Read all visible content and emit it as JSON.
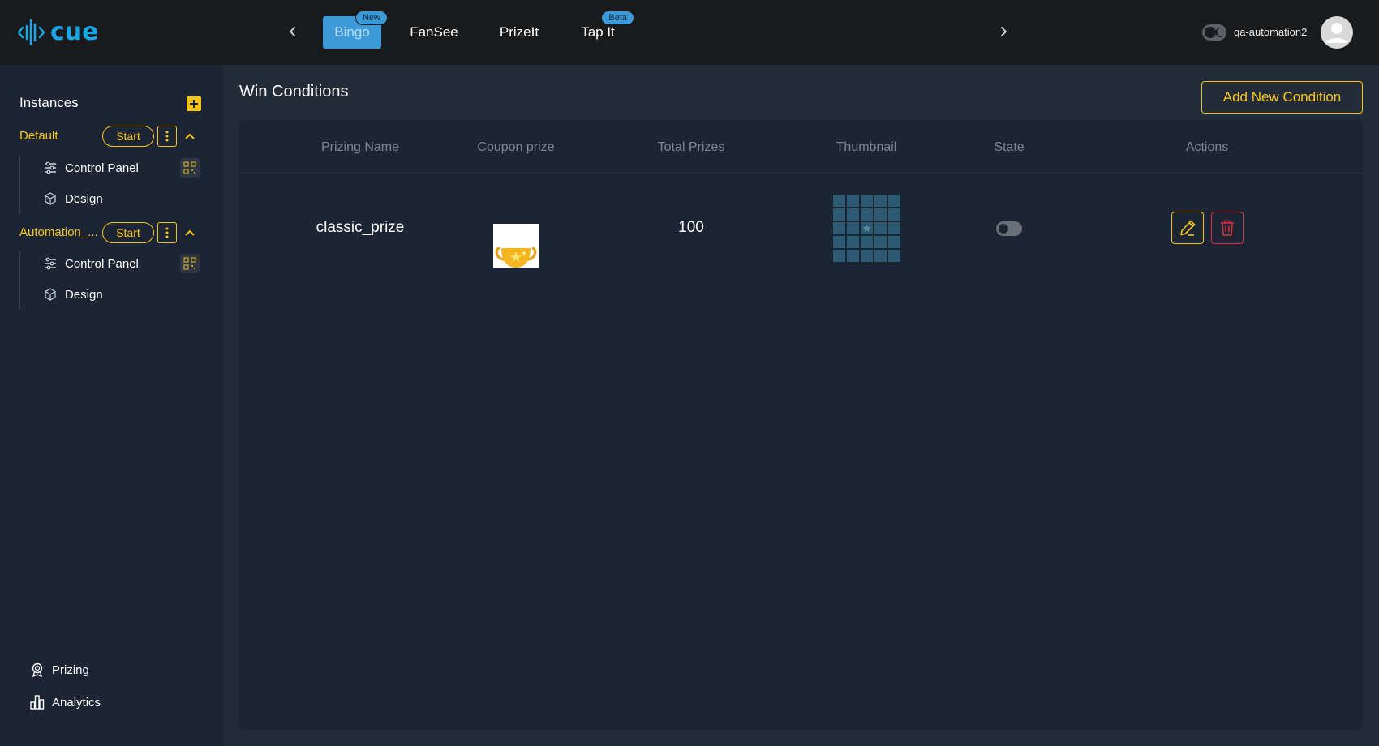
{
  "app": {
    "logo_text": "cue"
  },
  "topnav": {
    "tabs": [
      {
        "label": "Bingo",
        "badge": "New",
        "active": true
      },
      {
        "label": "FanSee",
        "badge": "",
        "active": false
      },
      {
        "label": "PrizeIt",
        "badge": "",
        "active": false
      },
      {
        "label": "Tap It",
        "badge": "Beta",
        "active": false
      }
    ],
    "username": "qa-automation2"
  },
  "sidebar": {
    "title": "Instances",
    "instances": [
      {
        "name": "Default",
        "start_label": "Start",
        "items": [
          {
            "label": "Control Panel",
            "icon": "sliders-icon"
          },
          {
            "label": "Design",
            "icon": "cube-icon"
          }
        ]
      },
      {
        "name": "Automation_...",
        "start_label": "Start",
        "items": [
          {
            "label": "Control Panel",
            "icon": "sliders-icon"
          },
          {
            "label": "Design",
            "icon": "cube-icon"
          }
        ]
      }
    ],
    "bottom_links": [
      {
        "label": "Prizing",
        "icon": "award-icon"
      },
      {
        "label": "Analytics",
        "icon": "bar-chart-icon"
      }
    ]
  },
  "main": {
    "title": "Win Conditions",
    "add_button": "Add New Condition",
    "table": {
      "columns": [
        "Prizing Name",
        "Coupon prize",
        "Total Prizes",
        "Thumbnail",
        "State",
        "Actions"
      ],
      "rows": [
        {
          "prizing_name": "classic_prize",
          "coupon_icon": "trophy-image",
          "total_prizes": "100",
          "state_on": false
        }
      ]
    }
  },
  "colors": {
    "accent": "#f6c614",
    "brand": "#1ba6e6",
    "danger": "#d9323a",
    "active_tab": "#3d9ad8"
  }
}
